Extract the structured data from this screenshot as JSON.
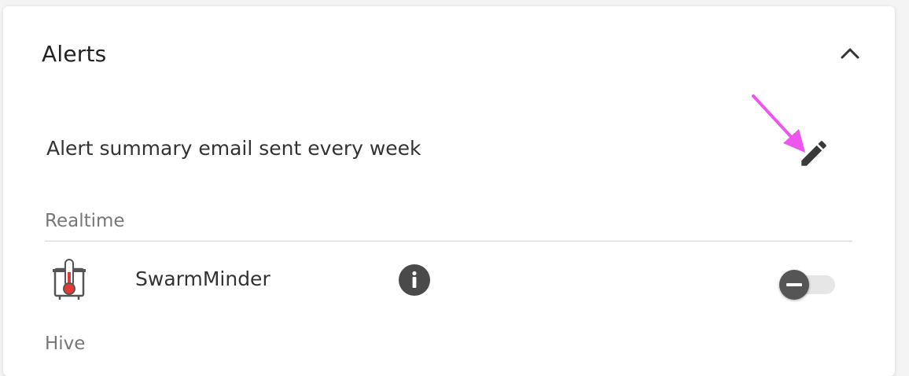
{
  "card": {
    "title": "Alerts",
    "collapse_icon": "chevron-up-icon"
  },
  "summary": {
    "text": "Alert summary email sent every week",
    "edit_icon": "pencil-icon",
    "annotation_color": "#ee55ee"
  },
  "sections": {
    "realtime": "Realtime",
    "hive": "Hive"
  },
  "devices": [
    {
      "name": "SwarmMinder",
      "icon": "thermometer-hive-icon",
      "info_icon": "info-icon",
      "toggle_state": "off"
    }
  ],
  "colors": {
    "text": "#333333",
    "muted": "#777777",
    "icon_dark": "#4a4a4a",
    "thermo_red": "#e53935"
  }
}
